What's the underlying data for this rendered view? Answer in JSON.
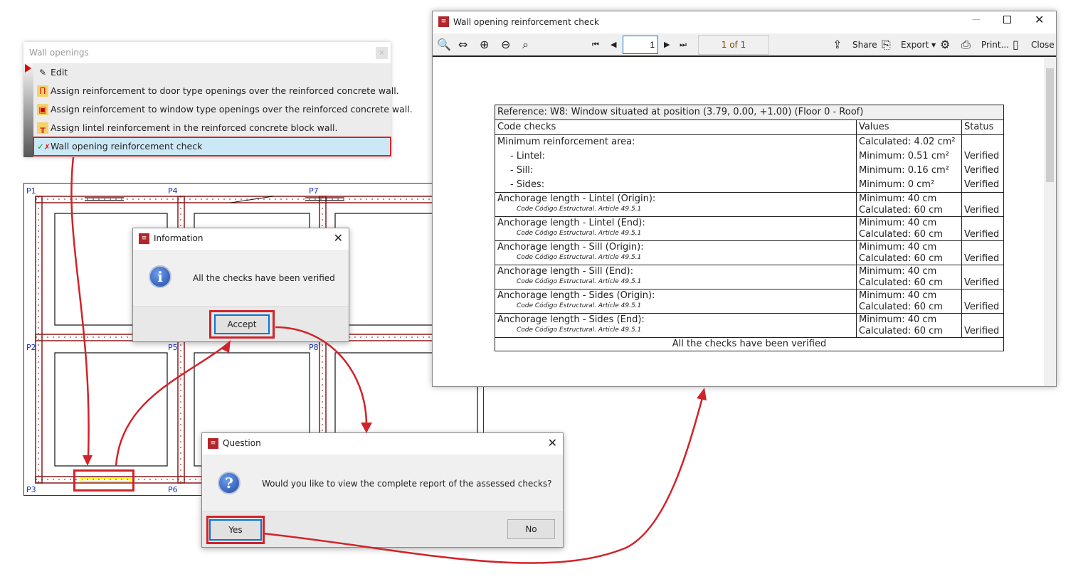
{
  "menu": {
    "title": "Wall openings",
    "close": "×",
    "items": [
      {
        "label": "Edit",
        "icon": "pencil-icon"
      },
      {
        "label": "Assign reinforcement to door type openings over the reinforced concrete wall.",
        "icon": "door-reinforcement-icon"
      },
      {
        "label": "Assign reinforcement to window type openings over the reinforced concrete wall.",
        "icon": "window-reinforcement-icon"
      },
      {
        "label": "Assign lintel reinforcement in the reinforced concrete block wall.",
        "icon": "lintel-icon"
      },
      {
        "label": "Wall opening reinforcement check",
        "icon": "check-cross-icon"
      }
    ]
  },
  "cad": {
    "columns": [
      "P1",
      "P4",
      "P7",
      "P2",
      "P5",
      "P8",
      "P3",
      "P6"
    ]
  },
  "info_dialog": {
    "title": "Information",
    "message": "All the checks have been verified",
    "accept": "Accept",
    "close": "✕"
  },
  "question_dialog": {
    "title": "Question",
    "message": "Would you like to view the complete report of the assessed checks?",
    "yes": "Yes",
    "no": "No",
    "close": "✕"
  },
  "report": {
    "title": "Wall opening reinforcement check",
    "page_input": "1",
    "page_count": "1 of 1",
    "toolbar": {
      "share": "Share",
      "export": "Export",
      "print": "Print...",
      "close": "Close"
    },
    "reference": "Reference:  W8: Window situated at position (3.79, 0.00, +1.00) (Floor 0 - Roof)",
    "headers": [
      "Code checks",
      "Values",
      "Status"
    ],
    "min_area": {
      "label": "Minimum  reinforcement  area:",
      "calculated": "Calculated: 4.02 cm²",
      "lines": [
        {
          "label": "- Lintel:",
          "value": "Minimum:  0.51  cm²",
          "status": "Verified"
        },
        {
          "label": "- Sill:",
          "value": "Minimum:  0.16  cm²",
          "status": "Verified"
        },
        {
          "label": "- Sides:",
          "value": "Minimum:  0  cm²",
          "status": "Verified"
        }
      ]
    },
    "anchorage": [
      {
        "label": "Anchorage length  - Lintel (Origin):",
        "code": "Code Código Estructural.  Article 49.5.1",
        "min": "Minimum:  40  cm",
        "calc": "Calculated: 60 cm",
        "status": "Verified"
      },
      {
        "label": "Anchorage length  - Lintel (End):",
        "code": "Code Código Estructural.  Article 49.5.1",
        "min": "Minimum:  40  cm",
        "calc": "Calculated: 60 cm",
        "status": "Verified"
      },
      {
        "label": "Anchorage length  - Sill (Origin):",
        "code": "Code Código Estructural.  Article 49.5.1",
        "min": "Minimum:  40  cm",
        "calc": "Calculated: 60 cm",
        "status": "Verified"
      },
      {
        "label": "Anchorage length  - Sill (End):",
        "code": "Code Código Estructural.  Article 49.5.1",
        "min": "Minimum:  40  cm",
        "calc": "Calculated: 60 cm",
        "status": "Verified"
      },
      {
        "label": "Anchorage length  - Sides (Origin):",
        "code": "Code Código Estructural.  Article 49.5.1",
        "min": "Minimum:  40  cm",
        "calc": "Calculated: 60 cm",
        "status": "Verified"
      },
      {
        "label": "Anchorage length  - Sides (End):",
        "code": "Code Código Estructural.  Article 49.5.1",
        "min": "Minimum:  40  cm",
        "calc": "Calculated: 60 cm",
        "status": "Verified"
      }
    ],
    "footer": "All the checks have been verified"
  },
  "colors": {
    "accent_red": "#d1232a",
    "wall_red": "#8b1a1a",
    "column_label": "#1b2fbf",
    "selection": "#cce8f6"
  }
}
